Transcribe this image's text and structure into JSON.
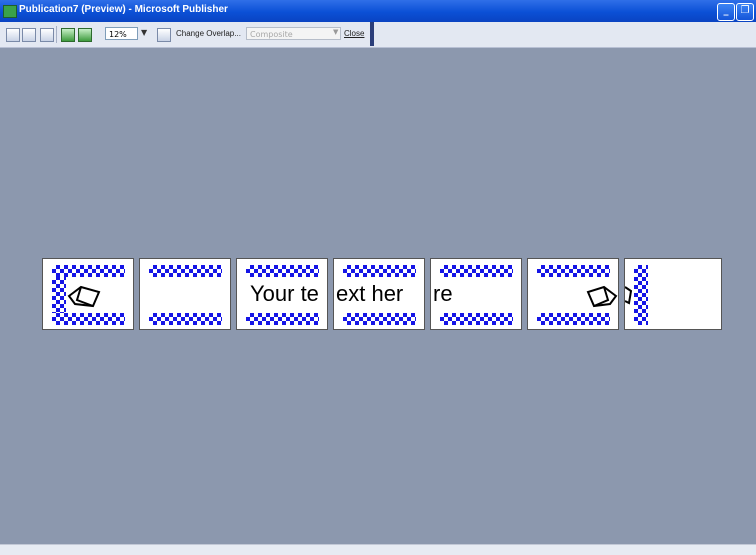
{
  "window": {
    "title": "Publication7 (Preview) - Microsoft Publisher",
    "minimize_glyph": "_",
    "restore_glyph": "❐"
  },
  "toolbar": {
    "zoom_value": "12%",
    "change_overlap_label": "Change Overlap...",
    "color_mode_value": "Composite",
    "close_label": "Close"
  },
  "banner": {
    "panel_text_1": "Your te",
    "panel_text_2": "ext her",
    "panel_text_3": "re"
  },
  "colors": {
    "checker": "#1515e6",
    "workspace": "#8c98ae",
    "titlebar": "#0b50d6"
  }
}
